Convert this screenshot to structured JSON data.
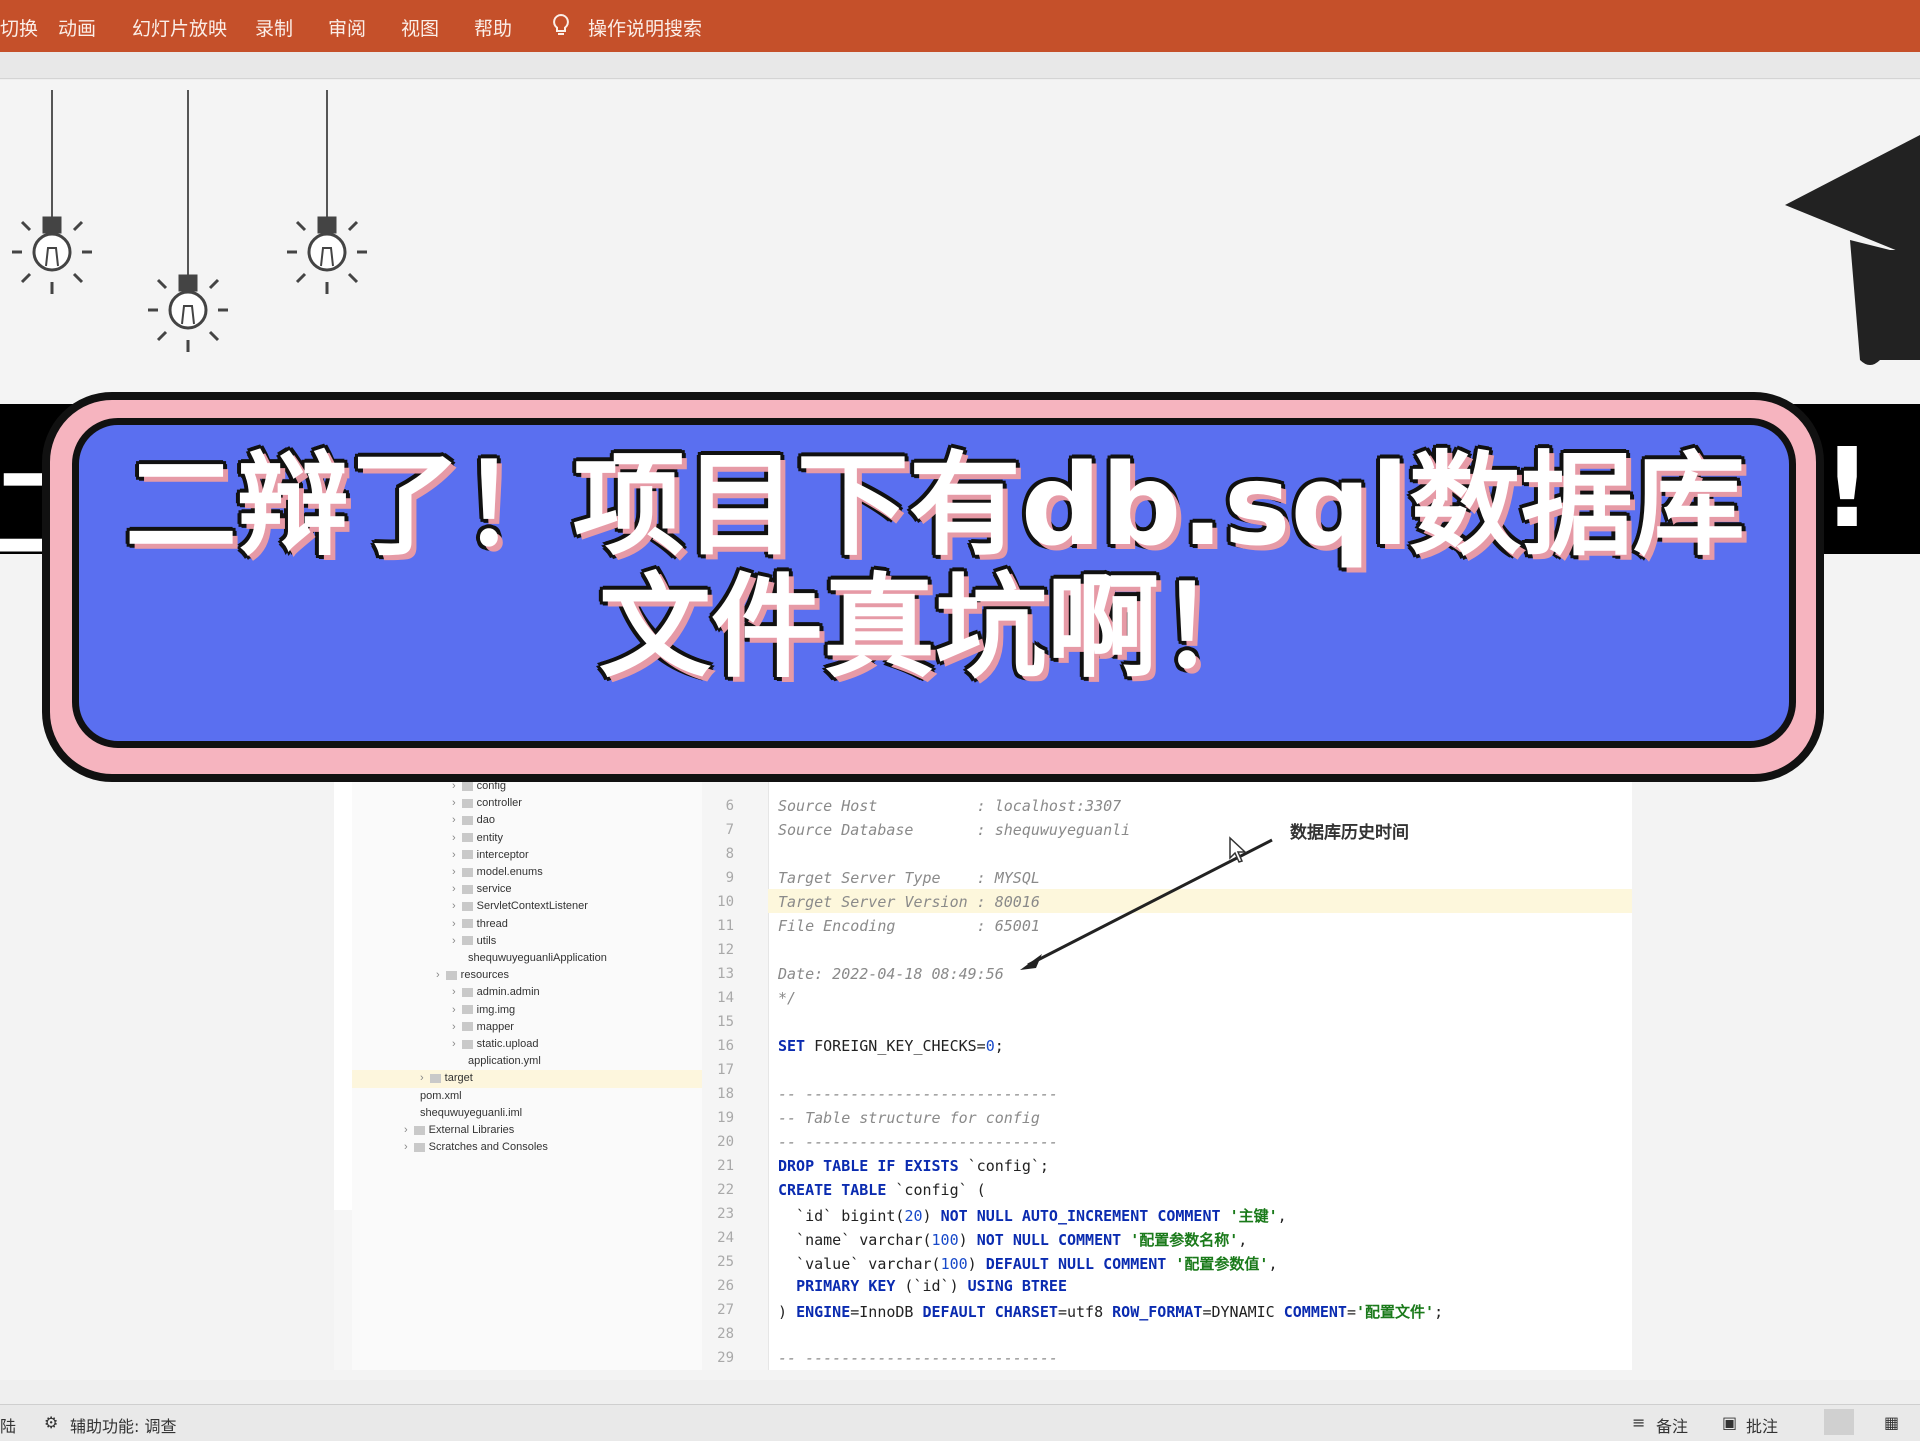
{
  "ribbon": {
    "tabs": [
      "切换",
      "动画",
      "幻灯片放映",
      "录制",
      "审阅",
      "视图",
      "帮助"
    ],
    "search_label": "操作说明搜索"
  },
  "slide": {
    "title_line1": "二辩了！项目下有db.sql数据库",
    "title_line2": "文件真坑啊！",
    "behind_left": "二",
    "behind_right": "!"
  },
  "project_tree": [
    {
      "label": "config",
      "depth": 2,
      "type": "folder"
    },
    {
      "label": "controller",
      "depth": 2,
      "type": "folder"
    },
    {
      "label": "dao",
      "depth": 2,
      "type": "folder"
    },
    {
      "label": "entity",
      "depth": 2,
      "type": "folder"
    },
    {
      "label": "interceptor",
      "depth": 2,
      "type": "folder"
    },
    {
      "label": "model.enums",
      "depth": 2,
      "type": "folder"
    },
    {
      "label": "service",
      "depth": 2,
      "type": "folder"
    },
    {
      "label": "ServletContextListener",
      "depth": 2,
      "type": "folder"
    },
    {
      "label": "thread",
      "depth": 2,
      "type": "folder"
    },
    {
      "label": "utils",
      "depth": 2,
      "type": "folder"
    },
    {
      "label": "shequwuyeguanliApplication",
      "depth": 3,
      "type": "class"
    },
    {
      "label": "resources",
      "depth": 1,
      "type": "folder"
    },
    {
      "label": "admin.admin",
      "depth": 2,
      "type": "folder"
    },
    {
      "label": "img.img",
      "depth": 2,
      "type": "folder"
    },
    {
      "label": "mapper",
      "depth": 2,
      "type": "folder"
    },
    {
      "label": "static.upload",
      "depth": 2,
      "type": "folder"
    },
    {
      "label": "application.yml",
      "depth": 3,
      "type": "file"
    },
    {
      "label": "target",
      "depth": 0,
      "type": "folder"
    },
    {
      "label": "pom.xml",
      "depth": 0,
      "type": "file"
    },
    {
      "label": "shequwuyeguanli.iml",
      "depth": 0,
      "type": "file"
    },
    {
      "label": "External Libraries",
      "depth": -1,
      "type": "folder"
    },
    {
      "label": "Scratches and Consoles",
      "depth": -1,
      "type": "folder"
    }
  ],
  "editor": {
    "lines": [
      {
        "n": "6",
        "text": "Source Host           : localhost:3307"
      },
      {
        "n": "7",
        "text": "Source Database       : shequwuyeguanli"
      },
      {
        "n": "8",
        "text": ""
      },
      {
        "n": "9",
        "text": "Target Server Type    : MYSQL"
      },
      {
        "n": "10",
        "text": "Target Server Version : 80016"
      },
      {
        "n": "11",
        "text": "File Encoding         : 65001"
      },
      {
        "n": "12",
        "text": ""
      },
      {
        "n": "13",
        "text": "Date: 2022-04-18 08:49:56"
      },
      {
        "n": "14",
        "text": "*/"
      },
      {
        "n": "15",
        "text": ""
      },
      {
        "n": "16",
        "text": "SET FOREIGN_KEY_CHECKS=0;"
      },
      {
        "n": "17",
        "text": ""
      },
      {
        "n": "18",
        "text": "-- ----------------------------"
      },
      {
        "n": "19",
        "text": "-- Table structure for config"
      },
      {
        "n": "20",
        "text": "-- ----------------------------"
      },
      {
        "n": "21",
        "text": "DROP TABLE IF EXISTS `config`;"
      },
      {
        "n": "22",
        "text": "CREATE TABLE `config` ("
      },
      {
        "n": "23",
        "text": "  `id` bigint(20) NOT NULL AUTO_INCREMENT COMMENT '主键',"
      },
      {
        "n": "24",
        "text": "  `name` varchar(100) NOT NULL COMMENT '配置参数名称',"
      },
      {
        "n": "25",
        "text": "  `value` varchar(100) DEFAULT NULL COMMENT '配置参数值',"
      },
      {
        "n": "26",
        "text": "  PRIMARY KEY (`id`) USING BTREE"
      },
      {
        "n": "27",
        "text": ") ENGINE=InnoDB DEFAULT CHARSET=utf8 ROW_FORMAT=DYNAMIC COMMENT='配置文件';"
      },
      {
        "n": "28",
        "text": ""
      },
      {
        "n": "29",
        "text": "-- ----------------------------"
      }
    ],
    "annotation": "数据库历史时间"
  },
  "status_bar": {
    "left_fragment": "陆",
    "accessibility": "辅助功能: 调查",
    "notes": "备注",
    "comments": "批注"
  },
  "colors": {
    "ribbon": "#c5502a",
    "card_fill": "#5a6ff0",
    "card_border": "#f6b4bf"
  }
}
